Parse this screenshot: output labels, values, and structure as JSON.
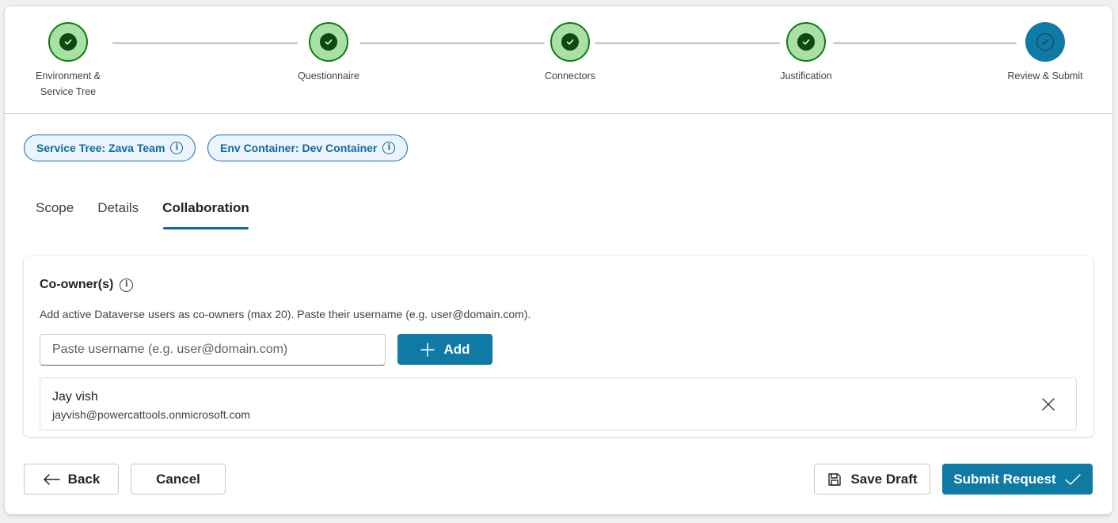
{
  "stepper": {
    "steps": [
      {
        "label_line1": "Environment &",
        "label_line2": "Service Tree",
        "status": "complete"
      },
      {
        "label_line1": "Questionnaire",
        "label_line2": "",
        "status": "complete"
      },
      {
        "label_line1": "Connectors",
        "label_line2": "",
        "status": "complete"
      },
      {
        "label_line1": "Justification",
        "label_line2": "",
        "status": "complete"
      },
      {
        "label_line1": "Review & Submit",
        "label_line2": "",
        "status": "current"
      }
    ]
  },
  "chips": [
    {
      "label": "Service Tree: Zava Team",
      "icon": "info-icon"
    },
    {
      "label": "Env Container: Dev Container",
      "icon": "info-icon"
    }
  ],
  "tabs": [
    {
      "label": "Scope",
      "active": false
    },
    {
      "label": "Details",
      "active": false
    },
    {
      "label": "Collaboration",
      "active": true
    }
  ],
  "coowners": {
    "title": "Co-owner(s)",
    "description": "Add active Dataverse users as co-owners (max 20). Paste their username (e.g. user@domain.com).",
    "input_placeholder": "Paste username (e.g. user@domain.com)",
    "input_value": "",
    "add_label": "Add",
    "users": [
      {
        "name": "Jay vish",
        "email": "jayvish@powercattools.onmicrosoft.com"
      }
    ]
  },
  "footer": {
    "back_label": "Back",
    "cancel_label": "Cancel",
    "save_draft_label": "Save Draft",
    "submit_label": "Submit Request"
  },
  "colors": {
    "accent": "#0f7aa3",
    "complete_fill": "#a8e0a5",
    "complete_border": "#107c10"
  }
}
